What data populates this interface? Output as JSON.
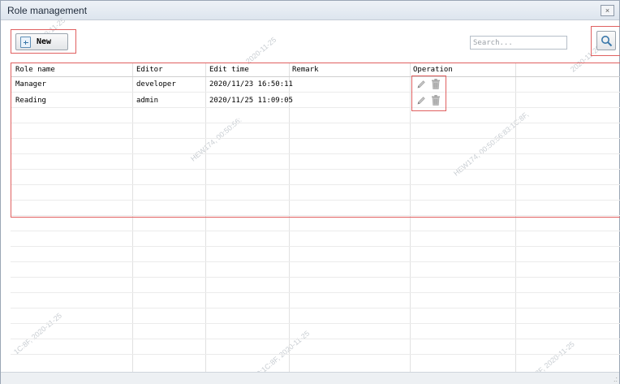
{
  "window": {
    "title": "Role management",
    "close_glyph": "×"
  },
  "toolbar": {
    "new_label": "New",
    "search_placeholder": "Search...",
    "search_icon": "magnifier-icon"
  },
  "table": {
    "columns": [
      "Role name",
      "Editor",
      "Edit time",
      "Remark",
      "Operation"
    ],
    "rows": [
      {
        "role_name": "Manager",
        "editor": "developer",
        "edit_time": "2020/11/23 16:50:11",
        "remark": "",
        "operation_icons": [
          "edit-icon",
          "delete-icon"
        ]
      },
      {
        "role_name": "Reading",
        "editor": "admin",
        "edit_time": "2020/11/25 11:09:05",
        "remark": "",
        "operation_icons": [
          "edit-icon",
          "delete-icon"
        ]
      }
    ]
  },
  "watermarks": {
    "date": "2020-11-25",
    "host_a": "HEW174, 00:50:56:",
    "host_b": "HEW174, 00:50:56:83:1C:8F,",
    "mac_tail": "1C:8F, 2020-11-25",
    "mac_tail_short": "3:1C:8F, 2020-11-25",
    "fragment": "56:83:1C:8F, 2020-11-25",
    "fragment_b": "1C:8F,"
  },
  "colors": {
    "highlight": "#e06060",
    "accent": "#3a78aa"
  }
}
